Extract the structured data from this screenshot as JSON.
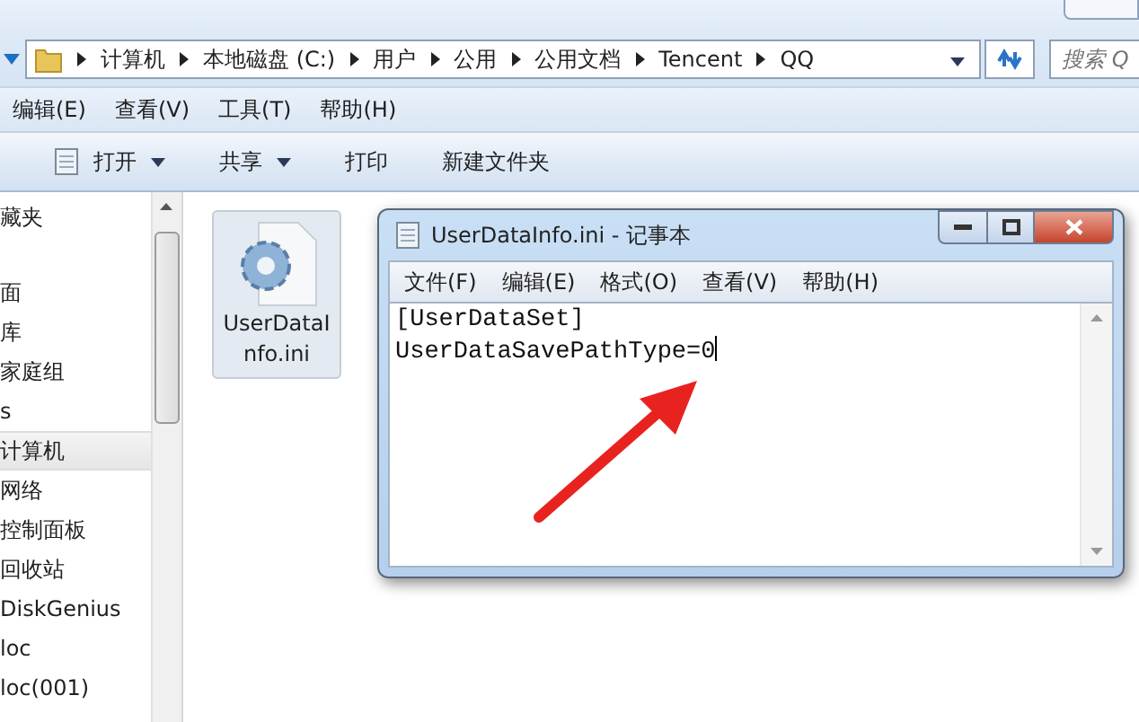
{
  "address_bar": {
    "crumbs": [
      "计算机",
      "本地磁盘 (C:)",
      "用户",
      "公用",
      "公用文档",
      "Tencent",
      "QQ"
    ]
  },
  "search": {
    "placeholder": "搜索 Q"
  },
  "menu_bar": [
    "编辑(E)",
    "查看(V)",
    "工具(T)",
    "帮助(H)"
  ],
  "toolbar": [
    {
      "label": "打开",
      "kind": "icon-dropdown"
    },
    {
      "label": "共享",
      "kind": "dropdown"
    },
    {
      "label": "打印",
      "kind": "plain"
    },
    {
      "label": "新建文件夹",
      "kind": "plain"
    }
  ],
  "sidebar": {
    "items": [
      {
        "label": "藏夹",
        "selected": false
      },
      {
        "label": "面",
        "selected": false
      },
      {
        "label": "库",
        "selected": false
      },
      {
        "label": "家庭组",
        "selected": false
      },
      {
        "label": "s",
        "selected": false
      },
      {
        "label": "计算机",
        "selected": true
      },
      {
        "label": "网络",
        "selected": false
      },
      {
        "label": "控制面板",
        "selected": false
      },
      {
        "label": "回收站",
        "selected": false
      },
      {
        "label": "DiskGenius",
        "selected": false
      },
      {
        "label": "loc",
        "selected": false
      },
      {
        "label": "loc(001)",
        "selected": false
      }
    ]
  },
  "files": [
    {
      "name": "UserDataInfo.ini",
      "selected": true
    }
  ],
  "notepad": {
    "title": "UserDataInfo.ini - 记事本",
    "menu": [
      "文件(F)",
      "编辑(E)",
      "格式(O)",
      "查看(V)",
      "帮助(H)"
    ],
    "lines": [
      "[UserDataSet]",
      "UserDataSavePathType=0"
    ]
  }
}
